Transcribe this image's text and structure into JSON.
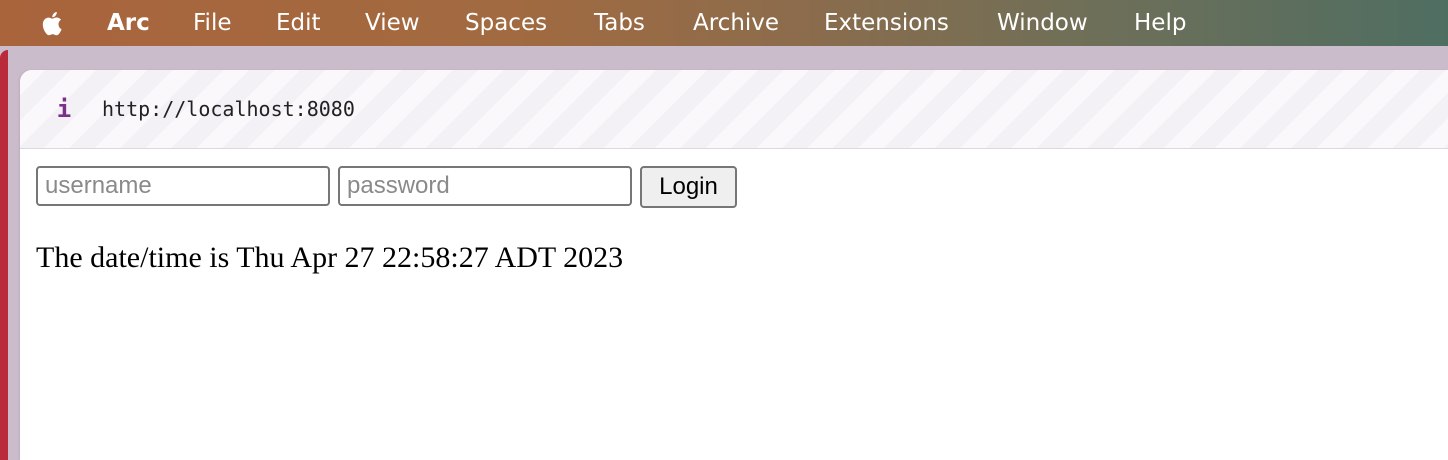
{
  "menubar": {
    "apple_icon": "apple-logo-icon",
    "app_name": "Arc",
    "items": [
      "File",
      "Edit",
      "View",
      "Spaces",
      "Tabs",
      "Archive",
      "Extensions",
      "Window",
      "Help"
    ]
  },
  "browser": {
    "info_icon": "info-icon",
    "info_glyph": "i",
    "url": "http://localhost:8080"
  },
  "page": {
    "username_placeholder": "username",
    "password_placeholder": "password",
    "login_label": "Login",
    "datetime_text": "The date/time is Thu Apr 27 22:58:27 ADT 2023"
  },
  "colors": {
    "accent": "#7a2f8a",
    "menubar_start": "#a9643c",
    "menubar_end": "#4f6e62"
  }
}
